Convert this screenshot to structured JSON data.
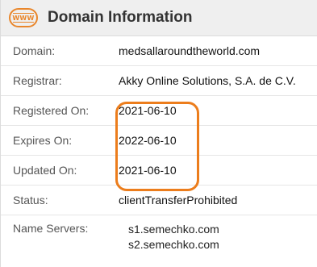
{
  "header": {
    "icon_name": "www-icon",
    "icon_text": "WWW",
    "title": "Domain Information",
    "accent_color": "#e9862b"
  },
  "rows": [
    {
      "label": "Domain:",
      "value": "medsallaroundtheworld.com"
    },
    {
      "label": "Registrar:",
      "value": "Akky Online Solutions, S.A. de C.V."
    },
    {
      "label": "Registered On:",
      "value": "2021-06-10"
    },
    {
      "label": "Expires On:",
      "value": "2022-06-10"
    },
    {
      "label": "Updated On:",
      "value": "2021-06-10"
    },
    {
      "label": "Status:",
      "value": "clientTransferProhibited"
    }
  ],
  "name_servers": {
    "label": "Name Servers:",
    "values": [
      "s1.semechko.com",
      "s2.semechko.com"
    ]
  },
  "highlight_color": "#ec7d1c"
}
